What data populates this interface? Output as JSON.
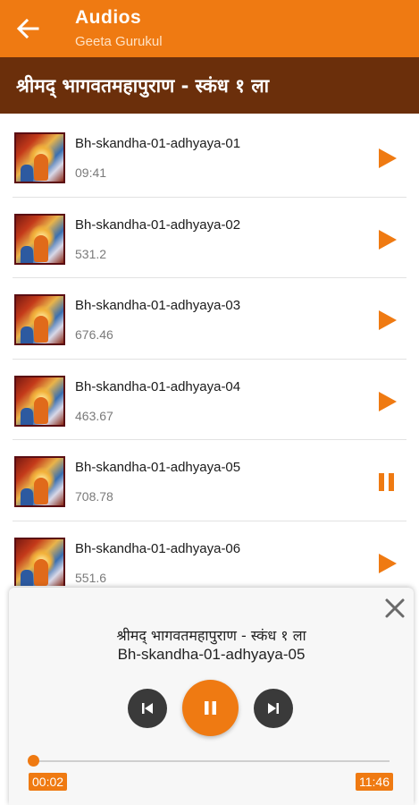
{
  "app": {
    "title": "Audios",
    "subtitle": "Geeta Gurukul"
  },
  "section": {
    "title": "श्रीमद् भागवतमहापुराण - स्कंध १ ला"
  },
  "colors": {
    "accent": "#ef7a12",
    "section_bg": "#6b2f0b"
  },
  "tracks": [
    {
      "name": "Bh-skandha-01-adhyaya-01",
      "duration": "09:41",
      "state": "play",
      "icon": "play-icon"
    },
    {
      "name": "Bh-skandha-01-adhyaya-02",
      "duration": "531.2",
      "state": "play",
      "icon": "play-icon"
    },
    {
      "name": "Bh-skandha-01-adhyaya-03",
      "duration": "676.46",
      "state": "play",
      "icon": "play-icon"
    },
    {
      "name": "Bh-skandha-01-adhyaya-04",
      "duration": "463.67",
      "state": "play",
      "icon": "play-icon"
    },
    {
      "name": "Bh-skandha-01-adhyaya-05",
      "duration": "708.78",
      "state": "pause",
      "icon": "pause-icon"
    },
    {
      "name": "Bh-skandha-01-adhyaya-06",
      "duration": "551.6",
      "state": "play",
      "icon": "play-icon"
    }
  ],
  "player": {
    "section": "श्रीमद् भागवतमहापुराण - स्कंध १ ला",
    "track": "Bh-skandha-01-adhyaya-05",
    "current_time": "00:02",
    "total_time": "11:46",
    "progress": 0.003
  }
}
